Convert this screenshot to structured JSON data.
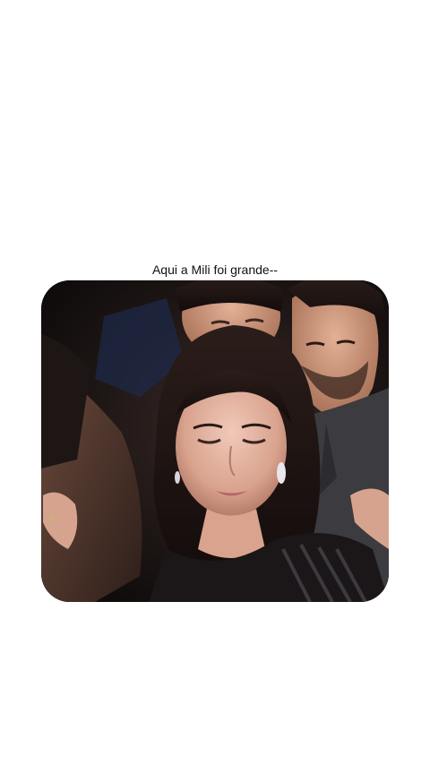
{
  "post": {
    "caption": "Aqui a Mili foi grande--"
  },
  "media": {
    "icon": "photo-icon"
  }
}
